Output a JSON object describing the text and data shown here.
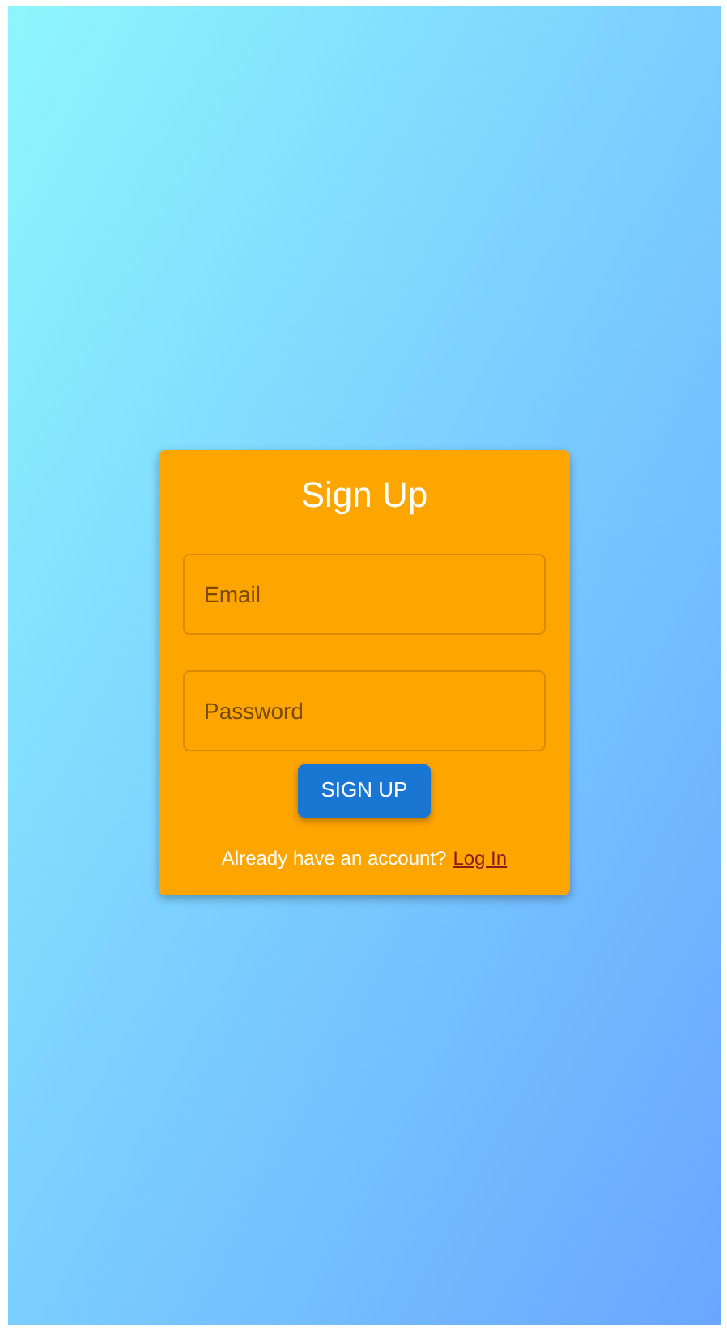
{
  "title": "Sign Up",
  "fields": [
    {
      "placeholder": "Email"
    },
    {
      "placeholder": "Password"
    }
  ],
  "submit": "SIGN UP",
  "footer": {
    "text": "Already have an account?",
    "link": "Log In"
  }
}
